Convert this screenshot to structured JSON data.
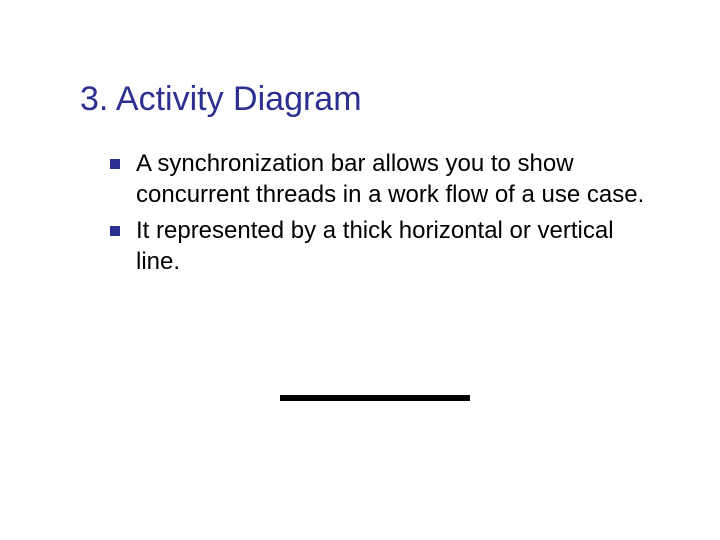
{
  "title": "3. Activity Diagram",
  "bullets": [
    "A synchronization bar allows you to show concurrent threads in a work flow of a use case.",
    "It represented by a thick horizontal or vertical line."
  ]
}
